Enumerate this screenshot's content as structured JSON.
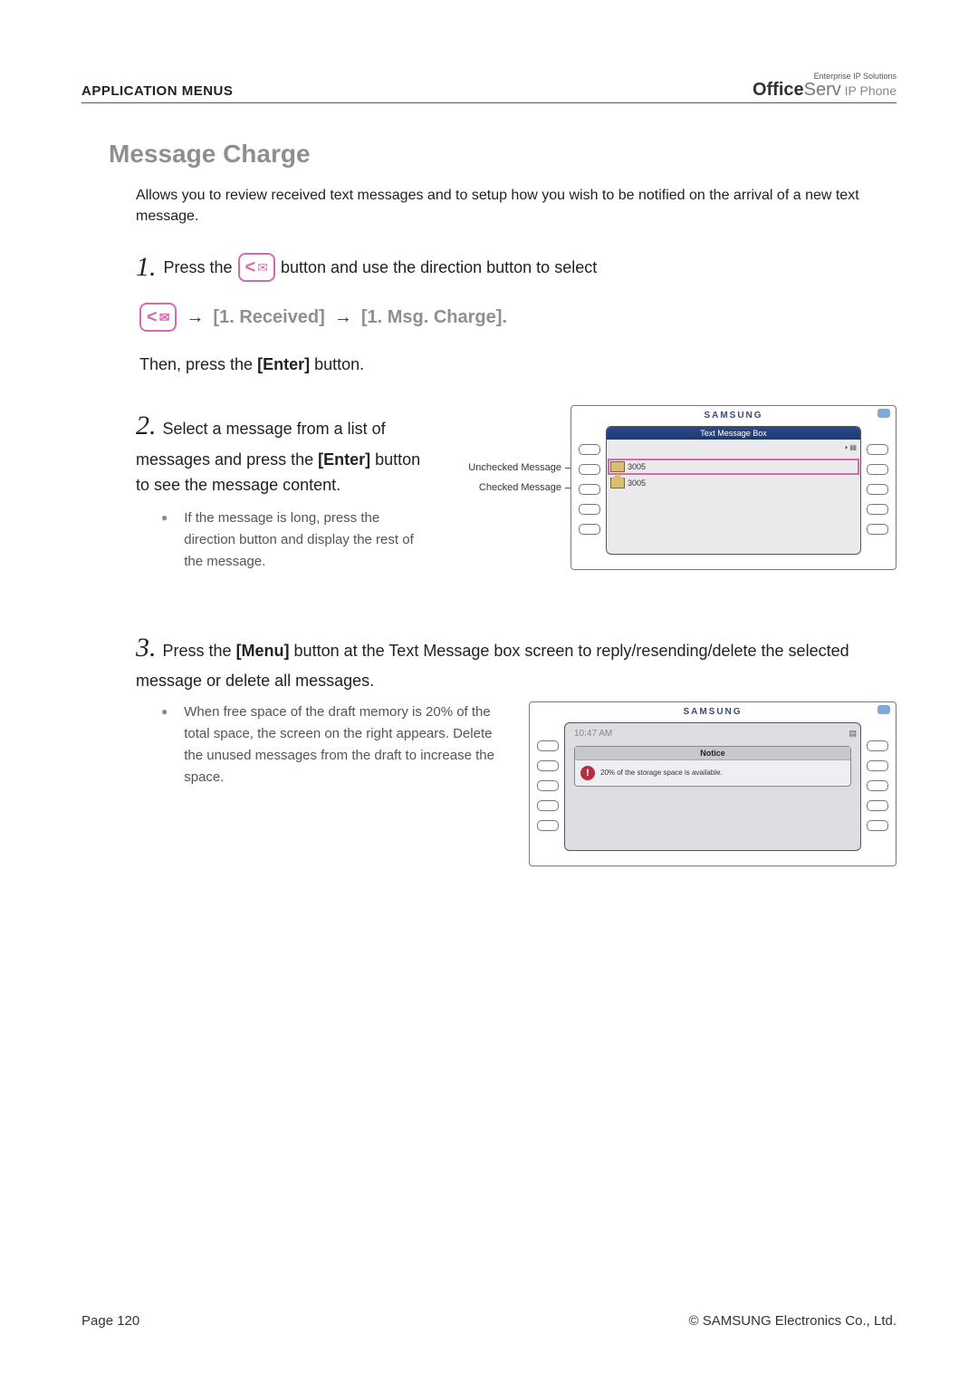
{
  "header": {
    "left": "APPLICATION MENUS",
    "brand_small": "Enterprise IP Solutions",
    "brand_bold": "Office",
    "brand_light": "Serv",
    "brand_tail": " IP Phone"
  },
  "section_title": "Message Charge",
  "intro": "Allows you to review received text messages and to setup how you wish to be notified on the arrival of a new text message.",
  "step1": {
    "num": "1.",
    "pre": "Press the ",
    "post": " button and use the direction button to select",
    "path1": "[1. Received]",
    "path2": "[1. Msg. Charge].",
    "then_pre": "Then, press the ",
    "then_bold": "[Enter]",
    "then_post": " button."
  },
  "step2": {
    "num": "2.",
    "line1": "Select a message from a list of messages and press the ",
    "line1_bold": "[Enter]",
    "line1_post": " button to see the message content.",
    "bullet": "If the message is long, press the direction button and display the rest of the message.",
    "label_unchecked": "Unchecked Message",
    "label_checked": "Checked Message",
    "device_brand": "SAMSUNG",
    "screen_title": "Text Message Box",
    "row1": "3005",
    "row2": "3005"
  },
  "step3": {
    "num": "3.",
    "line_pre": "Press the ",
    "line_bold": "[Menu]",
    "line_post": " button at the Text Message box screen to reply/resending/delete the selected message or delete all messages.",
    "bullet": "When free space of the draft memory is 20% of the total space, the screen on the right appears. Delete the unused messages from the draft to increase the space.",
    "device_brand": "SAMSUNG",
    "time": "10:47 AM",
    "notice_title": "Notice",
    "notice_body": "20% of the storage space is available."
  },
  "footer": {
    "left": "Page 120",
    "right": "© SAMSUNG Electronics Co., Ltd."
  }
}
